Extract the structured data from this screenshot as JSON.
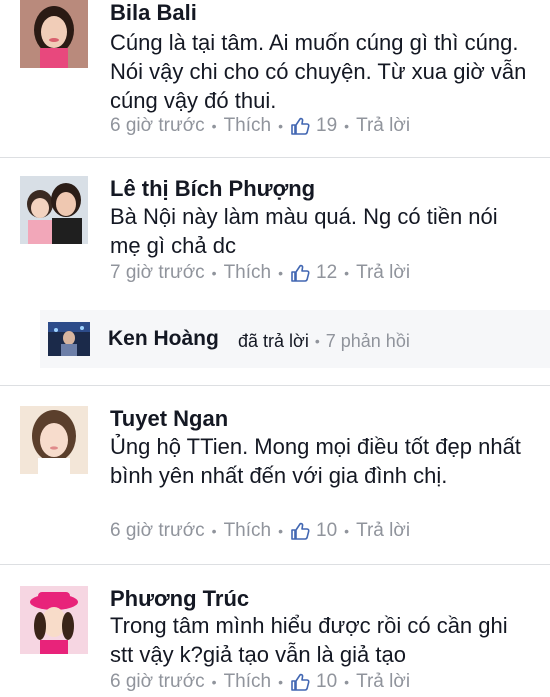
{
  "comments": [
    {
      "author": "Bila Bali",
      "text": "Cúng là tại tâm. Ai muốn cúng gì thì cúng. Nói vậy chi cho có chuyện. Từ xua giờ vẫn cúng vậy đó thui.",
      "time": "6 giờ trước",
      "like_label": "Thích",
      "like_count": "19",
      "reply_label": "Trả lời"
    },
    {
      "author": "Lê thị Bích Phượng",
      "text": "Bà Nội này làm màu quá. Ng có tiền nói mẹ gì chả dc",
      "time": "7 giờ trước",
      "like_label": "Thích",
      "like_count": "12",
      "reply_label": "Trả lời"
    },
    {
      "author": "Tuyet Ngan",
      "text": "Ủng hộ TTien. Mong mọi điều tốt đẹp nhất bình yên nhất đến với gia đình chị.",
      "time": "6 giờ trước",
      "like_label": "Thích",
      "like_count": "10",
      "reply_label": "Trả lời"
    },
    {
      "author": "Phương Trúc",
      "text": "Trong tâm mình hiểu được rồi có cần ghi stt vậy k?giả tạo vẫn là giả tạo",
      "time": "6 giờ trước",
      "like_label": "Thích",
      "like_count": "10",
      "reply_label": "Trả lời"
    }
  ],
  "reply_summary": {
    "name": "Ken Hoàng",
    "action": "đã trả lời",
    "count": "7 phản hồi"
  },
  "separator": "•",
  "icons": {
    "like": "thumbs-up-icon"
  },
  "colors": {
    "link_blue": "#4267b2",
    "meta_gray": "#90949c",
    "divider": "#dddfe2"
  }
}
